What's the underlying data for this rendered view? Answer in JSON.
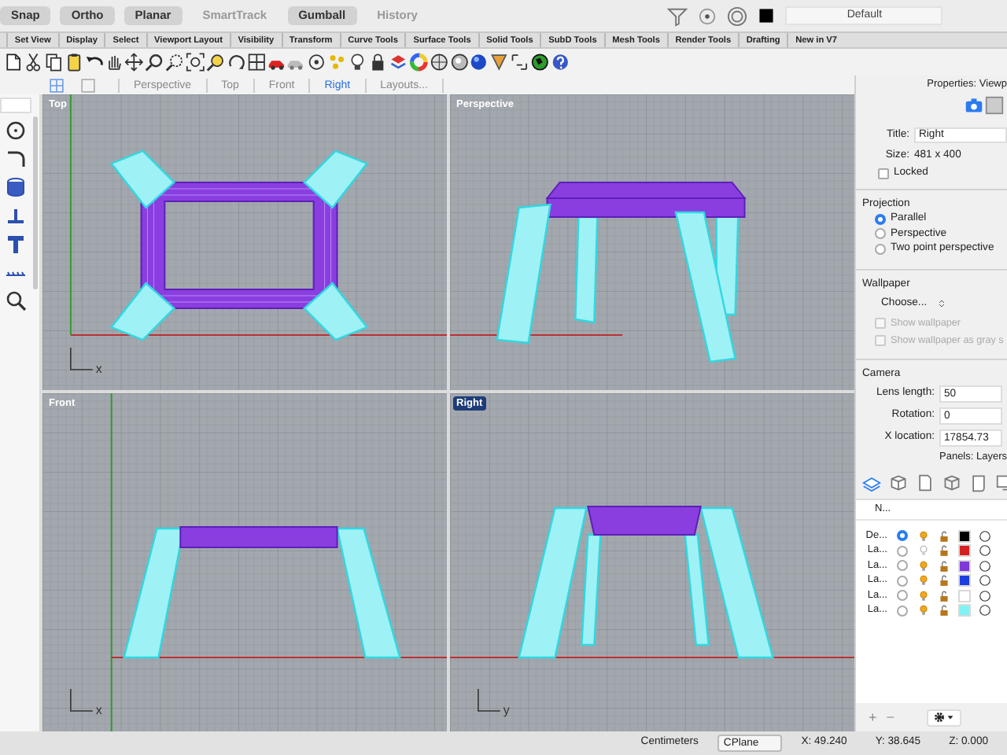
{
  "toggles": [
    {
      "label": "Snap",
      "on": true
    },
    {
      "label": "Ortho",
      "on": true
    },
    {
      "label": "Planar",
      "on": true
    },
    {
      "label": "SmartTrack",
      "on": false
    },
    {
      "label": "Gumball",
      "on": true
    },
    {
      "label": "History",
      "on": false
    }
  ],
  "layer_field": {
    "value": "Default"
  },
  "toolbar_tabs": [
    "Set View",
    "Display",
    "Select",
    "Viewport Layout",
    "Visibility",
    "Transform",
    "Curve Tools",
    "Surface Tools",
    "Solid Tools",
    "SubD Tools",
    "Mesh Tools",
    "Render Tools",
    "Drafting",
    "New in V7"
  ],
  "view_tabs": [
    {
      "label": "Perspective",
      "selected": false
    },
    {
      "label": "Top",
      "selected": false
    },
    {
      "label": "Front",
      "selected": false
    },
    {
      "label": "Right",
      "selected": true
    },
    {
      "label": "Layouts...",
      "selected": false
    }
  ],
  "viewports": [
    {
      "label": "Top",
      "kind": "top",
      "active": false,
      "axis_label": "x"
    },
    {
      "label": "Perspective",
      "kind": "perspective",
      "active": false
    },
    {
      "label": "Front",
      "kind": "front",
      "active": false,
      "axis_label": "x"
    },
    {
      "label": "Right",
      "kind": "right",
      "active": true,
      "axis_label": "y"
    }
  ],
  "properties": {
    "header": "Properties: Viewp",
    "fields": [
      {
        "label": "Title:",
        "value": "Right"
      }
    ],
    "size_label": "Size:",
    "size_value": "481 x 400",
    "locked": {
      "label": "Locked",
      "checked": false
    },
    "projection": {
      "heading": "Projection",
      "options": [
        {
          "label": "Parallel",
          "selected": true
        },
        {
          "label": "Perspective",
          "selected": false
        },
        {
          "label": "Two point perspective",
          "selected": false
        }
      ]
    },
    "wallpaper": {
      "heading": "Wallpaper",
      "choose": "Choose...",
      "options": [
        {
          "label": "Show wallpaper",
          "checked": false,
          "disabled": true
        },
        {
          "label": "Show wallpaper as gray s",
          "checked": false,
          "disabled": true
        }
      ]
    },
    "camera": {
      "heading": "Camera",
      "fields": [
        {
          "label": "Lens length:",
          "value": "50"
        },
        {
          "label": "Rotation:",
          "value": "0"
        },
        {
          "label": "X location:",
          "value": "17854.73"
        }
      ]
    }
  },
  "layers": {
    "header": "Panels: Layers",
    "column": "N...",
    "rows": [
      {
        "name": "De...",
        "current": true,
        "visible": true,
        "color": "#000000"
      },
      {
        "name": "La...",
        "current": false,
        "visible": false,
        "color": "#d62020"
      },
      {
        "name": "La...",
        "current": false,
        "visible": true,
        "color": "#8038d8"
      },
      {
        "name": "La...",
        "current": false,
        "visible": true,
        "color": "#1d3fe0"
      },
      {
        "name": "La...",
        "current": false,
        "visible": true,
        "color": "#ffffff"
      },
      {
        "name": "La...",
        "current": false,
        "visible": true,
        "color": "#80f2f4"
      }
    ],
    "add": "+",
    "remove": "−"
  },
  "status_bar": {
    "units": "Centimeters",
    "cplane": "CPlane",
    "x": "X: 49.240",
    "y": "Y: 38.645",
    "z": "Z: 0.000"
  }
}
